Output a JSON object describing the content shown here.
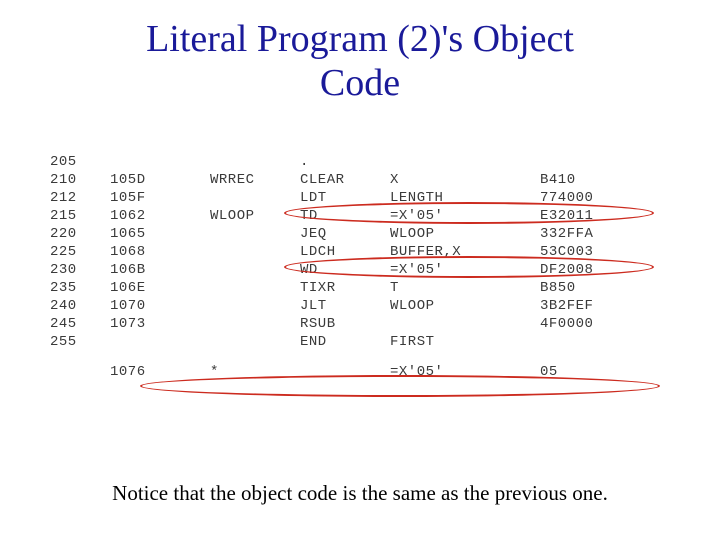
{
  "title_line1": "Literal Program (2)'s Object",
  "title_line2": "Code",
  "caption": "Notice that the object code is the same as the previous one.",
  "rows": [
    {
      "line": "205",
      "addr": "",
      "label": "",
      "op": ".",
      "arg": "",
      "obj": ""
    },
    {
      "line": "210",
      "addr": "105D",
      "label": "WRREC",
      "op": "CLEAR",
      "arg": "X",
      "obj": "B410"
    },
    {
      "line": "212",
      "addr": "105F",
      "label": "",
      "op": "LDT",
      "arg": "LENGTH",
      "obj": "774000"
    },
    {
      "line": "215",
      "addr": "1062",
      "label": "WLOOP",
      "op": "TD",
      "arg": "=X'05'",
      "obj": "E32011"
    },
    {
      "line": "220",
      "addr": "1065",
      "label": "",
      "op": "JEQ",
      "arg": "WLOOP",
      "obj": "332FFA"
    },
    {
      "line": "225",
      "addr": "1068",
      "label": "",
      "op": "LDCH",
      "arg": "BUFFER,X",
      "obj": "53C003"
    },
    {
      "line": "230",
      "addr": "106B",
      "label": "",
      "op": "WD",
      "arg": "=X'05'",
      "obj": "DF2008"
    },
    {
      "line": "235",
      "addr": "106E",
      "label": "",
      "op": "TIXR",
      "arg": "T",
      "obj": "B850"
    },
    {
      "line": "240",
      "addr": "1070",
      "label": "",
      "op": "JLT",
      "arg": "WLOOP",
      "obj": "3B2FEF"
    },
    {
      "line": "245",
      "addr": "1073",
      "label": "",
      "op": "RSUB",
      "arg": "",
      "obj": "4F0000"
    },
    {
      "line": "255",
      "addr": "",
      "label": "",
      "op": "END",
      "arg": "FIRST",
      "obj": ""
    },
    {
      "line": "",
      "addr": "1076",
      "label": "*",
      "op": "",
      "arg": "=X'05'",
      "obj": "05"
    }
  ]
}
